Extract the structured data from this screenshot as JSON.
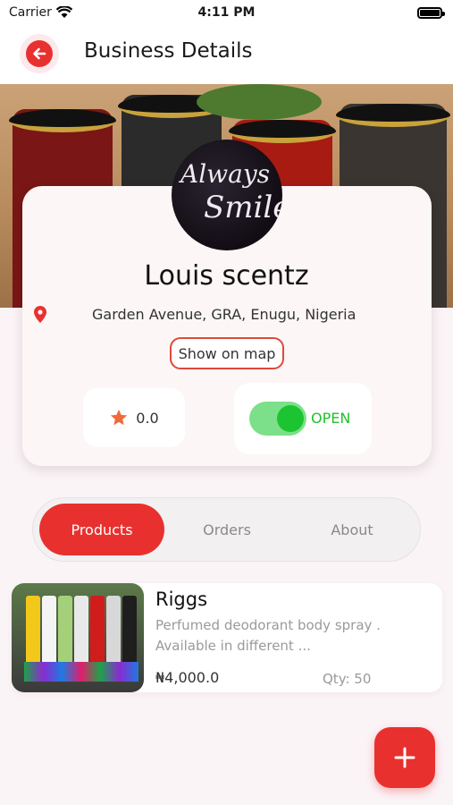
{
  "status_bar": {
    "carrier": "Carrier",
    "time": "4:11 PM"
  },
  "header": {
    "title": "Business Details"
  },
  "business": {
    "logo_text_line1": "Always",
    "logo_text_line2": "Smile",
    "name": "Louis scentz",
    "address": "Garden Avenue, GRA, Enugu, Nigeria",
    "show_on_map_label": "Show on map",
    "rating": "0.0",
    "status_label": "OPEN",
    "is_open": true
  },
  "tabs": [
    {
      "label": "Products",
      "active": true
    },
    {
      "label": "Orders",
      "active": false
    },
    {
      "label": "About",
      "active": false
    }
  ],
  "products": [
    {
      "name": "Riggs",
      "description": "Perfumed deodorant body spray . Available in different ...",
      "price": "₦4,000.0",
      "quantity": "Qty: 50"
    }
  ],
  "colors": {
    "accent": "#e8312f",
    "open_green": "#22c02c",
    "toggle_track": "#7be089",
    "toggle_knob": "#1cc431",
    "star": "#f06a3a"
  },
  "icons": {
    "back": "arrow-left-icon",
    "location": "map-pin-icon",
    "rating": "star-icon",
    "add": "plus-icon"
  }
}
